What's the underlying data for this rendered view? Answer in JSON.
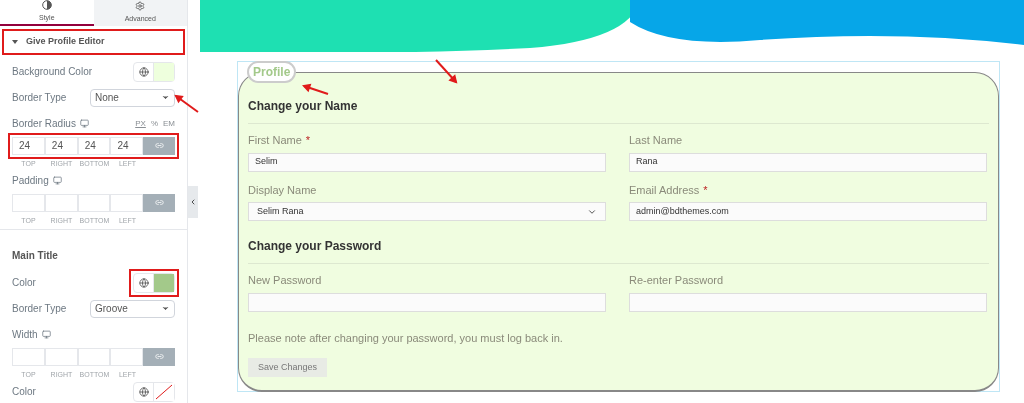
{
  "sidebar": {
    "tabs": [
      {
        "label": "Style",
        "kind": "style",
        "selected": true
      },
      {
        "label": "Advanced",
        "kind": "advanced",
        "selected": false
      }
    ],
    "section": {
      "title": "Give Profile Editor",
      "expanded": true,
      "highlighted": true
    },
    "controls": [
      {
        "kind": "color",
        "label": "Background Color",
        "color": "#eeffdd",
        "highlighted": false
      },
      {
        "kind": "select",
        "label": "Border Type",
        "value": "None"
      },
      {
        "kind": "dimensions",
        "label": "Border Radius",
        "units": [
          "PX",
          "%",
          "EM"
        ],
        "values": [
          "24",
          "24",
          "24",
          "24"
        ],
        "sides": [
          "TOP",
          "RIGHT",
          "BOTTOM",
          "LEFT"
        ],
        "highlighted": true
      },
      {
        "kind": "dimensions",
        "label": "Padding",
        "sides": [
          "TOP",
          "RIGHT",
          "BOTTOM",
          "LEFT"
        ],
        "highlighted": false
      },
      {
        "kind": "heading",
        "label": "Main Title"
      },
      {
        "kind": "color",
        "label": "Color",
        "color": "#a3c98a",
        "highlighted": true
      },
      {
        "kind": "select",
        "label": "Border Type",
        "value": "Groove"
      },
      {
        "kind": "dimensions",
        "label": "Width",
        "sides": [
          "TOP",
          "RIGHT",
          "BOTTOM",
          "LEFT"
        ],
        "highlighted": false
      },
      {
        "kind": "color",
        "label": "Color",
        "highlighted": false
      }
    ]
  },
  "form": {
    "legend": "Profile",
    "sections": [
      {
        "title": "Change your Name",
        "fields": [
          {
            "label": "First Name",
            "mark": "*",
            "kind": "text",
            "value": "Selim"
          },
          {
            "label": "Last Name",
            "kind": "text",
            "value": "Rana"
          },
          {
            "label": "Display Name",
            "kind": "select",
            "value": "Selim Rana"
          },
          {
            "label": "Email Address",
            "mark": "*",
            "kind": "text",
            "value": "admin@bdthemes.com"
          }
        ]
      },
      {
        "title": "Change your Password",
        "fields": [
          {
            "label": "New Password",
            "kind": "text"
          },
          {
            "label": "Re-enter Password",
            "kind": "text"
          }
        ]
      }
    ],
    "note": "Please note after changing your password, you must log back in.",
    "button": "Save Changes"
  }
}
